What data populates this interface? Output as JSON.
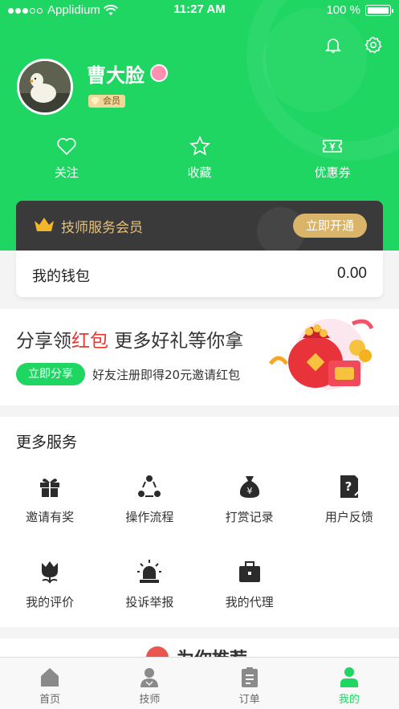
{
  "status_bar": {
    "carrier": "Applidium",
    "time": "11:27 AM",
    "battery": "100 %"
  },
  "profile": {
    "name": "曹大脸",
    "badge": "会员"
  },
  "quick_actions": [
    {
      "label": "关注",
      "icon": "heart-icon"
    },
    {
      "label": "收藏",
      "icon": "star-icon"
    },
    {
      "label": "优惠券",
      "icon": "coupon-icon"
    }
  ],
  "vip_card": {
    "title": "技师服务会员",
    "button": "立即开通"
  },
  "wallet": {
    "label": "我的钱包",
    "value": "0.00"
  },
  "share_banner": {
    "title_part1": "分享领",
    "title_red": "红包",
    "title_part2": " 更多好礼等你拿",
    "button": "立即分享",
    "description": "好友注册即得20元邀请红包"
  },
  "services": {
    "title": "更多服务",
    "items": [
      {
        "label": "邀请有奖",
        "icon": "gift-icon"
      },
      {
        "label": "操作流程",
        "icon": "process-icon"
      },
      {
        "label": "打赏记录",
        "icon": "money-bag-icon"
      },
      {
        "label": "用户反馈",
        "icon": "feedback-icon"
      },
      {
        "label": "我的评价",
        "icon": "tulip-icon"
      },
      {
        "label": "投诉举报",
        "icon": "alarm-icon"
      },
      {
        "label": "我的代理",
        "icon": "briefcase-icon"
      }
    ]
  },
  "recommend": {
    "title": "为你推荐"
  },
  "tabs": [
    {
      "label": "首页",
      "icon": "home-icon"
    },
    {
      "label": "技师",
      "icon": "technician-icon"
    },
    {
      "label": "订单",
      "icon": "order-icon"
    },
    {
      "label": "我的",
      "icon": "user-icon",
      "active": true
    }
  ],
  "colors": {
    "primary": "#1fd663",
    "vip_gold": "#d9b469",
    "accent_red": "#e6382f"
  }
}
